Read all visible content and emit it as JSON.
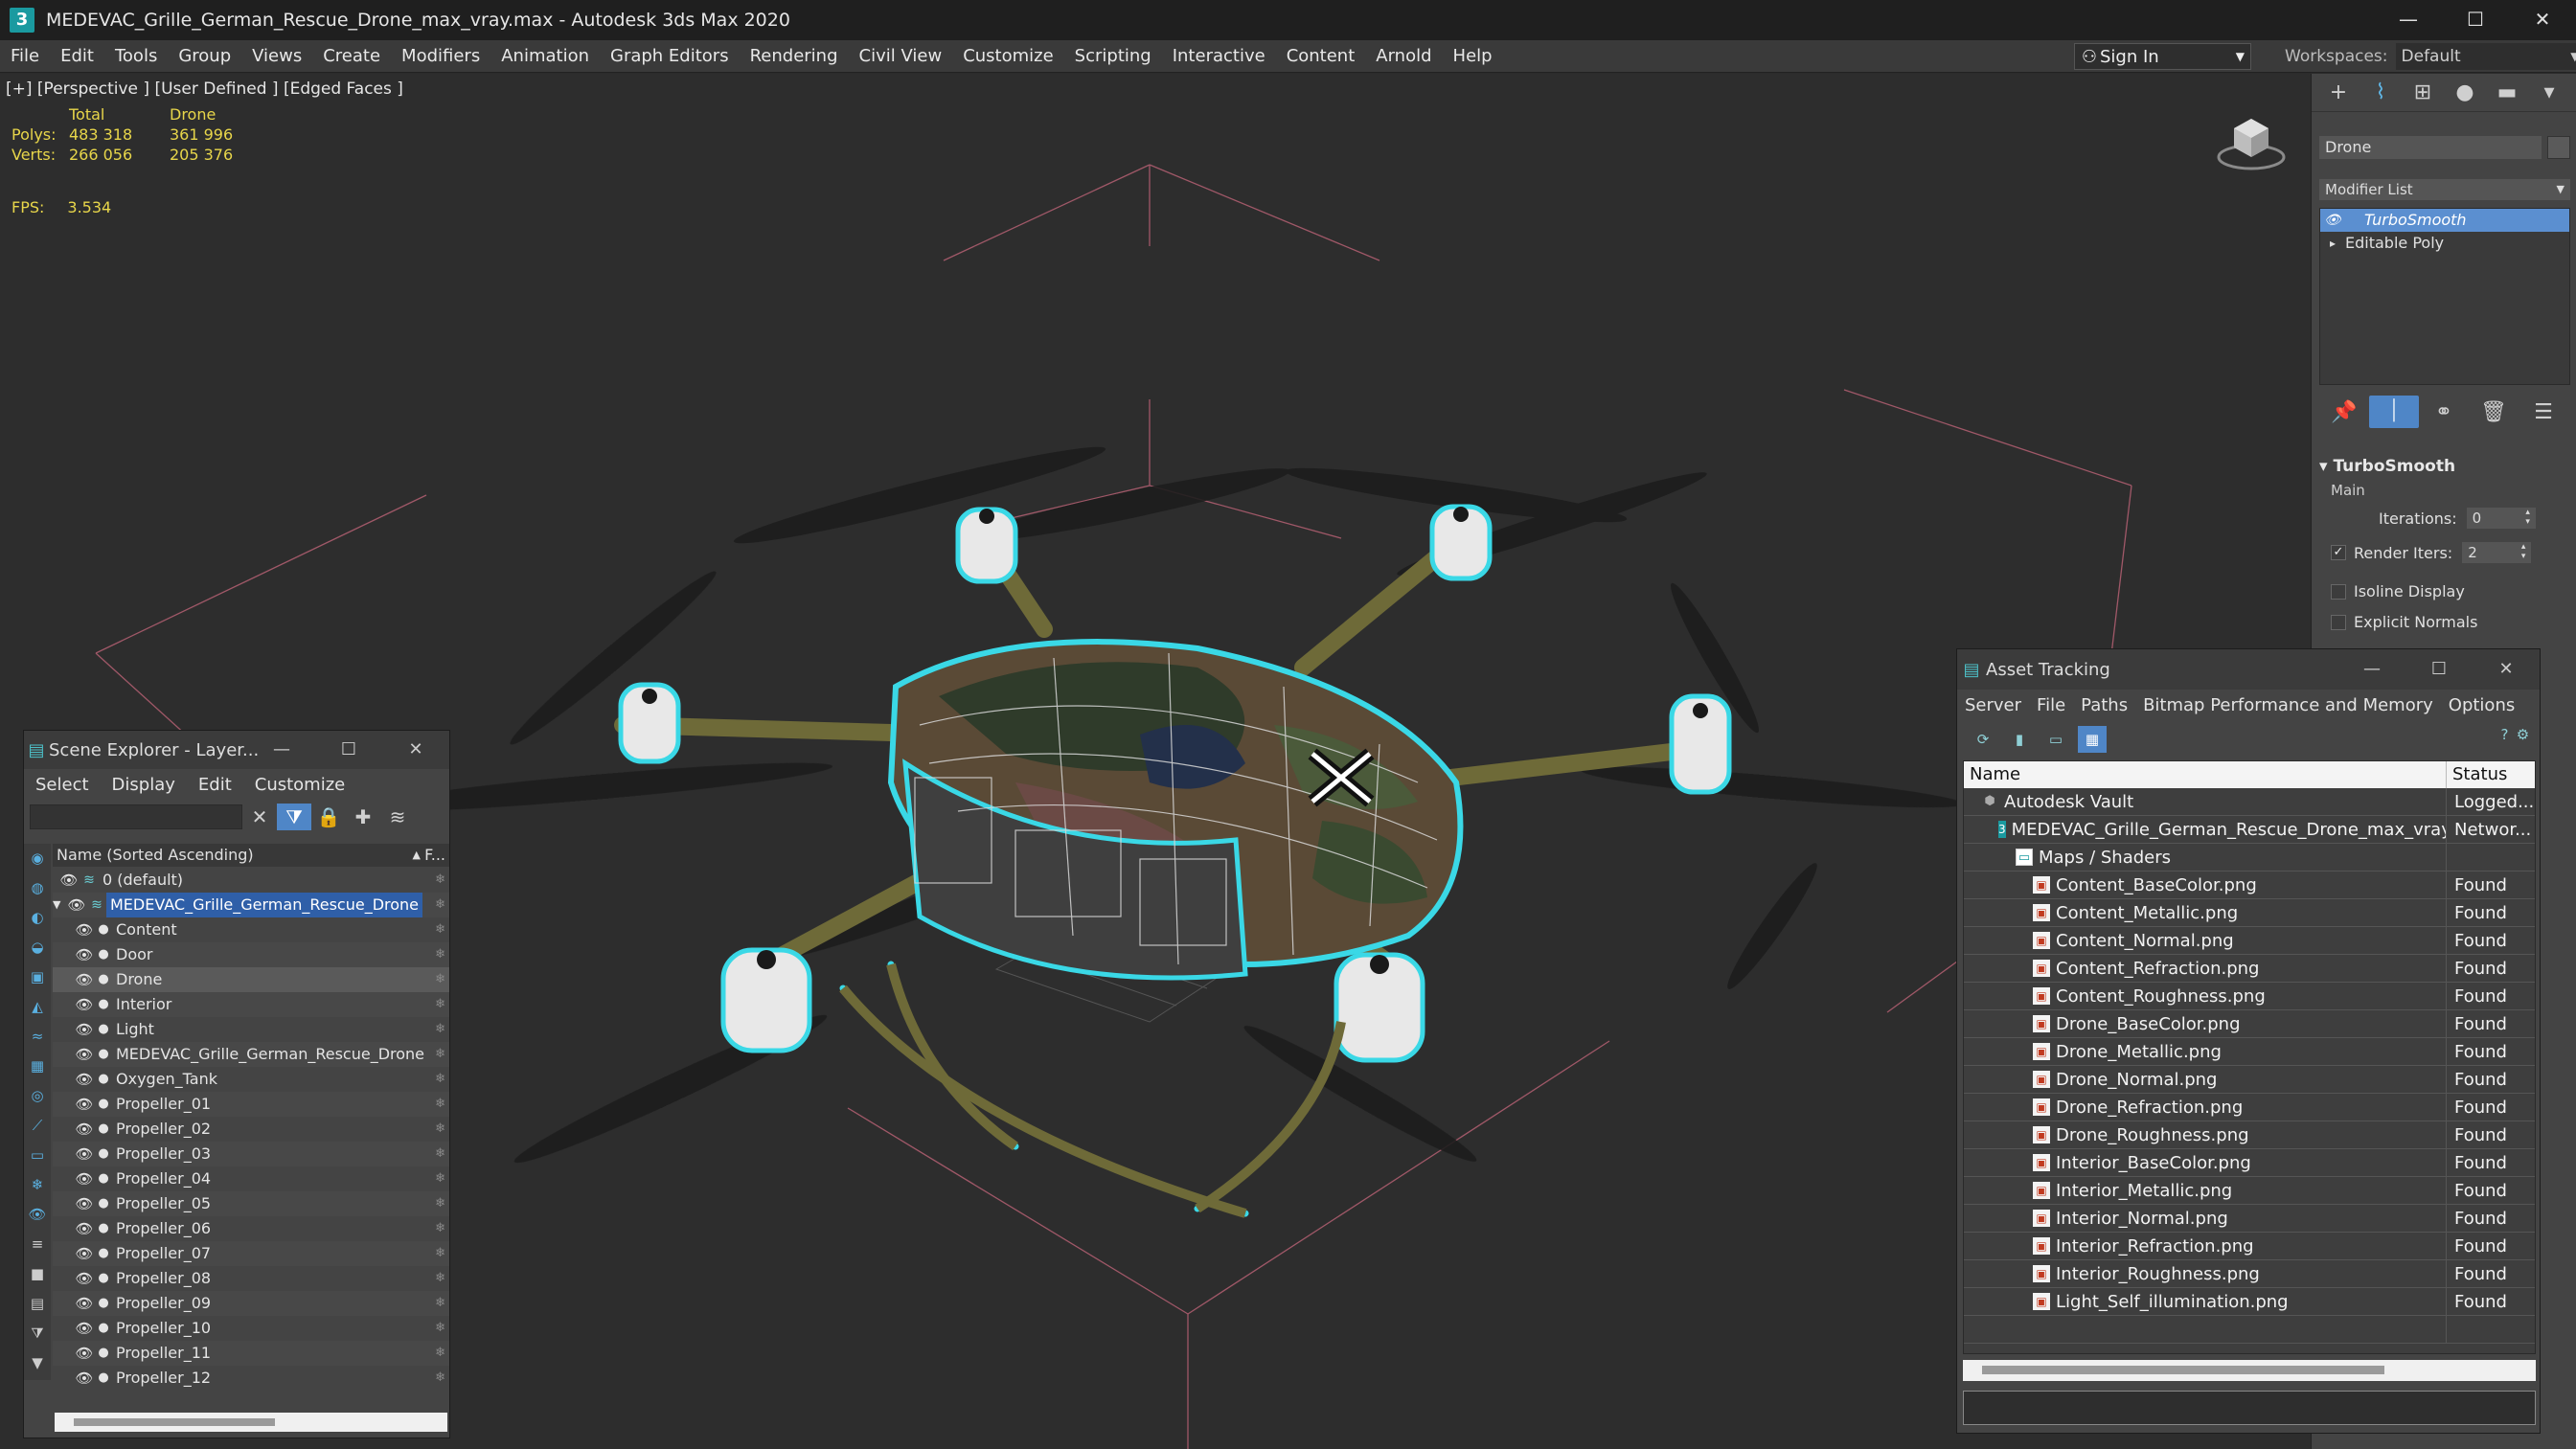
{
  "titlebar": {
    "title": "MEDEVAC_Grille_German_Rescue_Drone_max_vray.max - Autodesk 3ds Max 2020",
    "app_icon": "3",
    "minimize": "—",
    "maximize": "☐",
    "close": "✕"
  },
  "menu": {
    "items": [
      "File",
      "Edit",
      "Tools",
      "Group",
      "Views",
      "Create",
      "Modifiers",
      "Animation",
      "Graph Editors",
      "Rendering",
      "Civil View",
      "Customize",
      "Scripting",
      "Interactive",
      "Content",
      "Arnold",
      "Help"
    ],
    "sign_in": "Sign In",
    "workspaces_label": "Workspaces:",
    "workspaces_value": "Default"
  },
  "viewport": {
    "label": "[+] [Perspective ] [User Defined ] [Edged Faces ]",
    "stats_header_total": "Total",
    "stats_header_drone": "Drone",
    "polys_label": "Polys:",
    "polys_total": "483 318",
    "polys_drone": "361 996",
    "verts_label": "Verts:",
    "verts_total": "266 056",
    "verts_drone": "205 376",
    "fps_label": "FPS:",
    "fps_value": "3.534"
  },
  "command_panel": {
    "object_name": "Drone",
    "modifier_list": "Modifier List",
    "stack": [
      "TurboSmooth",
      "Editable Poly"
    ],
    "rollout_title": "TurboSmooth",
    "main_label": "Main",
    "iterations_label": "Iterations:",
    "iterations_value": "0",
    "render_iters_label": "Render Iters:",
    "render_iters_value": "2",
    "isoline_label": "Isoline Display",
    "explicit_normals_label": "Explicit Normals"
  },
  "scene_explorer": {
    "title": "Scene Explorer - Layer...",
    "menu": [
      "Select",
      "Display",
      "Edit",
      "Customize"
    ],
    "column_name": "Name (Sorted Ascending)",
    "column_f": "F...",
    "rows": [
      {
        "name": "0 (default)",
        "kind": "layer"
      },
      {
        "name": "MEDEVAC_Grille_German_Rescue_Drone",
        "kind": "layer-open"
      },
      {
        "name": "Content",
        "kind": "obj"
      },
      {
        "name": "Door",
        "kind": "obj"
      },
      {
        "name": "Drone",
        "kind": "obj-sel"
      },
      {
        "name": "Interior",
        "kind": "obj"
      },
      {
        "name": "Light",
        "kind": "obj"
      },
      {
        "name": "MEDEVAC_Grille_German_Rescue_Drone",
        "kind": "obj-group"
      },
      {
        "name": "Oxygen_Tank",
        "kind": "obj"
      },
      {
        "name": "Propeller_01",
        "kind": "obj"
      },
      {
        "name": "Propeller_02",
        "kind": "obj"
      },
      {
        "name": "Propeller_03",
        "kind": "obj"
      },
      {
        "name": "Propeller_04",
        "kind": "obj"
      },
      {
        "name": "Propeller_05",
        "kind": "obj"
      },
      {
        "name": "Propeller_06",
        "kind": "obj"
      },
      {
        "name": "Propeller_07",
        "kind": "obj"
      },
      {
        "name": "Propeller_08",
        "kind": "obj"
      },
      {
        "name": "Propeller_09",
        "kind": "obj"
      },
      {
        "name": "Propeller_10",
        "kind": "obj"
      },
      {
        "name": "Propeller_11",
        "kind": "obj"
      },
      {
        "name": "Propeller_12",
        "kind": "obj"
      }
    ]
  },
  "asset_tracking": {
    "title": "Asset Tracking",
    "menu": [
      "Server",
      "File",
      "Paths",
      "Bitmap Performance and Memory",
      "Options"
    ],
    "col_name": "Name",
    "col_status": "Status",
    "rows": [
      {
        "name": "Autodesk Vault",
        "status": "Logged...",
        "icon": "vault",
        "indent": 1
      },
      {
        "name": "MEDEVAC_Grille_German_Rescue_Drone_max_vray.max",
        "status": "Networ...",
        "icon": "max",
        "indent": 2
      },
      {
        "name": "Maps / Shaders",
        "status": "",
        "icon": "fold",
        "indent": 3
      },
      {
        "name": "Content_BaseColor.png",
        "status": "Found",
        "icon": "img",
        "indent": 4
      },
      {
        "name": "Content_Metallic.png",
        "status": "Found",
        "icon": "img",
        "indent": 4
      },
      {
        "name": "Content_Normal.png",
        "status": "Found",
        "icon": "img",
        "indent": 4
      },
      {
        "name": "Content_Refraction.png",
        "status": "Found",
        "icon": "img",
        "indent": 4
      },
      {
        "name": "Content_Roughness.png",
        "status": "Found",
        "icon": "img",
        "indent": 4
      },
      {
        "name": "Drone_BaseColor.png",
        "status": "Found",
        "icon": "img",
        "indent": 4
      },
      {
        "name": "Drone_Metallic.png",
        "status": "Found",
        "icon": "img",
        "indent": 4
      },
      {
        "name": "Drone_Normal.png",
        "status": "Found",
        "icon": "img",
        "indent": 4
      },
      {
        "name": "Drone_Refraction.png",
        "status": "Found",
        "icon": "img",
        "indent": 4
      },
      {
        "name": "Drone_Roughness.png",
        "status": "Found",
        "icon": "img",
        "indent": 4
      },
      {
        "name": "Interior_BaseColor.png",
        "status": "Found",
        "icon": "img",
        "indent": 4
      },
      {
        "name": "Interior_Metallic.png",
        "status": "Found",
        "icon": "img",
        "indent": 4
      },
      {
        "name": "Interior_Normal.png",
        "status": "Found",
        "icon": "img",
        "indent": 4
      },
      {
        "name": "Interior_Refraction.png",
        "status": "Found",
        "icon": "img",
        "indent": 4
      },
      {
        "name": "Interior_Roughness.png",
        "status": "Found",
        "icon": "img",
        "indent": 4
      },
      {
        "name": "Light_Self_illumination.png",
        "status": "Found",
        "icon": "img",
        "indent": 4
      }
    ]
  },
  "colors": {
    "selection_outline": "#3ad8e6",
    "grid_box": "#b06070",
    "stats_text": "#e8d64a",
    "accent_blue": "#4f86c7"
  }
}
